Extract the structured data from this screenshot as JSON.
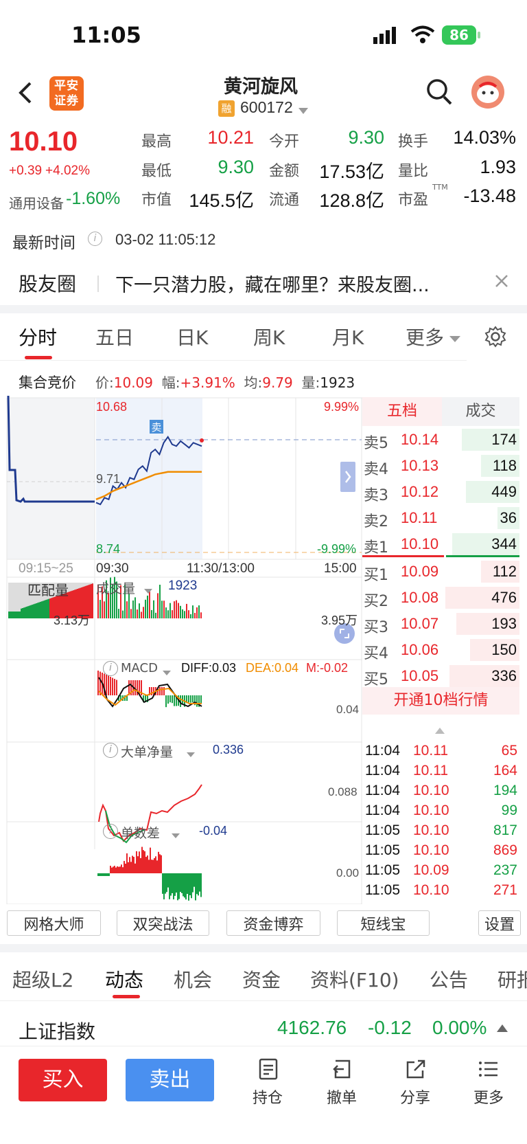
{
  "status_bar": {
    "time": "11:05",
    "battery": "86"
  },
  "header": {
    "broker_logo": "平安证券",
    "stock_name": "黄河旋风",
    "rong_badge": "融",
    "stock_code": "600172"
  },
  "quote": {
    "price": "10.10",
    "change": "+0.39",
    "change_pct": "+4.02%",
    "sector_name": "通用设备",
    "sector_pct": "-1.60%",
    "stats": [
      {
        "label": "最高",
        "value": "10.21",
        "color": "red"
      },
      {
        "label": "今开",
        "value": "9.30",
        "color": "green"
      },
      {
        "label": "换手",
        "value": "14.03%",
        "color": "black"
      },
      {
        "label": "最低",
        "value": "9.30",
        "color": "green"
      },
      {
        "label": "金额",
        "value": "17.53亿",
        "color": "black"
      },
      {
        "label": "量比",
        "value": "1.93",
        "color": "black"
      },
      {
        "label": "市值",
        "value": "145.5亿",
        "color": "black"
      },
      {
        "label": "流通",
        "value": "128.8亿",
        "color": "black"
      },
      {
        "label": "市盈",
        "value": "-13.48",
        "color": "black"
      }
    ],
    "pe_superscript": "TTM",
    "update_label": "最新时间",
    "update_time": "03-02 11:05:12"
  },
  "banner": {
    "title": "股友圈",
    "text": "下一只潜力股，藏在哪里？来股友圈..."
  },
  "chart_tabs": [
    "分时",
    "五日",
    "日K",
    "周K",
    "月K",
    "更多"
  ],
  "auction": {
    "label": "集合竞价",
    "price_label": "价:",
    "price": "10.09",
    "amp_label": "幅:",
    "amp": "+3.91%",
    "avg_label": "均:",
    "avg": "9.79",
    "vol_label": "量:",
    "vol": "1923"
  },
  "chart_labels": {
    "high": "10.68",
    "mid": "9.71",
    "low": "8.74",
    "pct_high": "9.99%",
    "pct_low": "-9.99%",
    "time_pre": "09:15~25",
    "time_open": "09:30",
    "time_mid": "11:30/13:00",
    "time_close": "15:00",
    "sell_marker": "卖",
    "match_vol": "匹配量",
    "match_max": "3.13万",
    "vol_label": "成交量",
    "vol_value": "1923",
    "vol_max": "3.95万",
    "macd_label": "MACD",
    "diff": "DIFF:0.03",
    "dea": "DEA:0.04",
    "m": "M:-0.02",
    "macd_axis": "0.04",
    "big_label": "大单净量",
    "big_value": "0.336",
    "big_axis": "0.088",
    "diff_label": "单数差",
    "diff_value": "-0.04",
    "diff_axis": "0.00"
  },
  "chart_data": {
    "type": "line",
    "title": "",
    "x_ticks": [
      "09:15~25",
      "09:30",
      "11:30/13:00",
      "15:00"
    ],
    "ylim": [
      8.74,
      10.68
    ],
    "reference_price": 9.71,
    "series": [
      {
        "values": [
          9.42,
          9.4,
          9.48,
          9.46,
          9.62,
          9.58,
          9.66,
          9.6,
          9.72,
          9.7,
          9.82,
          9.86,
          9.8,
          10.02,
          10.06,
          10.0,
          10.14,
          10.21,
          10.12,
          10.1,
          10.16,
          10.12,
          10.08,
          10.14,
          10.12,
          10.1
        ]
      },
      {
        "values": [
          9.46,
          9.48,
          9.5,
          9.53,
          9.56,
          9.58,
          9.6,
          9.62,
          9.64,
          9.66,
          9.68,
          9.7,
          9.72,
          9.74,
          9.76,
          9.77,
          9.78,
          9.79,
          9.79,
          9.79,
          9.79,
          9.79,
          9.79,
          9.79,
          9.79,
          9.79
        ]
      }
    ]
  },
  "order_book": {
    "tab_active": "五档",
    "tab_other": "成交",
    "asks": [
      {
        "label": "卖5",
        "price": "10.14",
        "vol": "174"
      },
      {
        "label": "卖4",
        "price": "10.13",
        "vol": "118"
      },
      {
        "label": "卖3",
        "price": "10.12",
        "vol": "449"
      },
      {
        "label": "卖2",
        "price": "10.11",
        "vol": "36"
      },
      {
        "label": "卖1",
        "price": "10.10",
        "vol": "344"
      }
    ],
    "bids": [
      {
        "label": "买1",
        "price": "10.09",
        "vol": "112"
      },
      {
        "label": "买2",
        "price": "10.08",
        "vol": "476"
      },
      {
        "label": "买3",
        "price": "10.07",
        "vol": "193"
      },
      {
        "label": "买4",
        "price": "10.06",
        "vol": "150"
      },
      {
        "label": "买5",
        "price": "10.05",
        "vol": "336"
      }
    ],
    "open_level10": "开通10档行情"
  },
  "ticks": [
    {
      "time": "11:04",
      "price": "10.11",
      "vol": "65",
      "color": "red"
    },
    {
      "time": "11:04",
      "price": "10.11",
      "vol": "164",
      "color": "red"
    },
    {
      "time": "11:04",
      "price": "10.10",
      "vol": "194",
      "color": "green"
    },
    {
      "time": "11:04",
      "price": "10.10",
      "vol": "99",
      "color": "green"
    },
    {
      "time": "11:05",
      "price": "10.10",
      "vol": "817",
      "color": "green"
    },
    {
      "time": "11:05",
      "price": "10.10",
      "vol": "869",
      "color": "red"
    },
    {
      "time": "11:05",
      "price": "10.09",
      "vol": "237",
      "color": "green"
    },
    {
      "time": "11:05",
      "price": "10.10",
      "vol": "271",
      "color": "red"
    }
  ],
  "func_buttons": [
    "网格大师",
    "双突战法",
    "资金博弈",
    "短线宝",
    "设置"
  ],
  "bottom_tabs": [
    "超级L2",
    "动态",
    "机会",
    "资金",
    "资料(F10)",
    "公告",
    "研报"
  ],
  "index_bar": {
    "name": "上证指数",
    "value": "4162.76",
    "change": "-0.12",
    "pct": "0.00%"
  },
  "toolbar": {
    "buy": "买入",
    "sell": "卖出",
    "items": [
      "持仓",
      "撤单",
      "分享",
      "更多"
    ]
  }
}
